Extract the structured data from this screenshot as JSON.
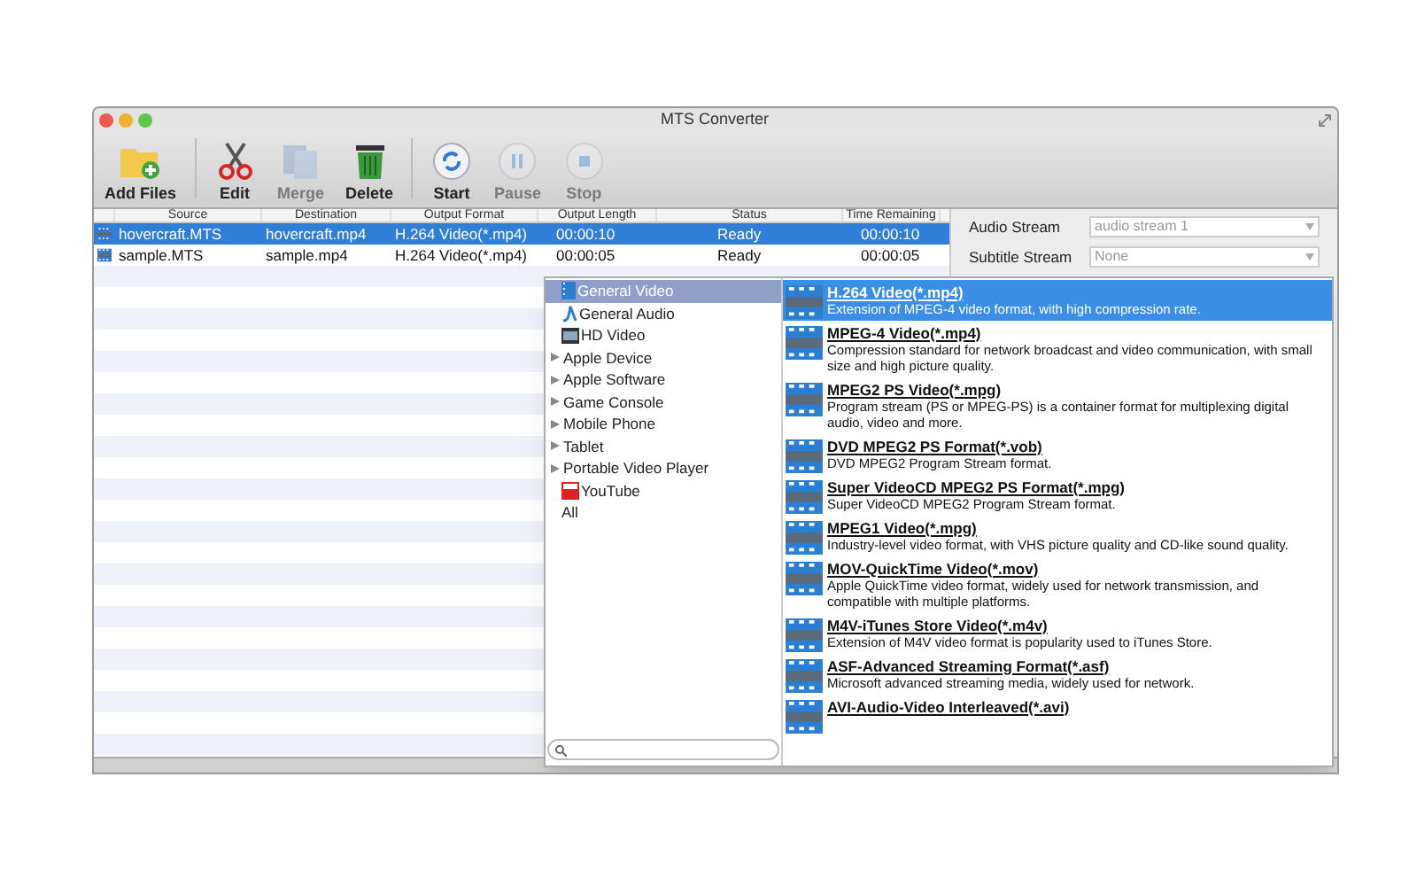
{
  "window": {
    "title": "MTS Converter"
  },
  "toolbar": [
    {
      "label": "Add Files",
      "kind": "add",
      "disabled": false
    },
    {
      "label": "Edit",
      "kind": "edit",
      "disabled": false
    },
    {
      "label": "Merge",
      "kind": "merge",
      "disabled": true
    },
    {
      "label": "Delete",
      "kind": "delete",
      "disabled": false
    },
    {
      "label": "Start",
      "kind": "start",
      "disabled": false
    },
    {
      "label": "Pause",
      "kind": "pause",
      "disabled": true
    },
    {
      "label": "Stop",
      "kind": "stop",
      "disabled": true
    }
  ],
  "table": {
    "columns": [
      "Source",
      "Destination",
      "Output Format",
      "Output Length",
      "Status",
      "Time Remaining"
    ],
    "rows": [
      {
        "selected": true,
        "cells": [
          "hovercraft.MTS",
          "hovercraft.mp4",
          "H.264 Video(*.mp4)",
          "00:00:10",
          "Ready",
          "00:00:10"
        ]
      },
      {
        "selected": false,
        "cells": [
          "sample.MTS",
          "sample.mp4",
          "H.264 Video(*.mp4)",
          "00:00:05",
          "Ready",
          "00:00:05"
        ]
      }
    ]
  },
  "streams": [
    {
      "label": "Audio Stream",
      "value": "audio stream 1"
    },
    {
      "label": "Subtitle Stream",
      "value": "None"
    }
  ],
  "categories": [
    {
      "label": "General Video",
      "kind": "video",
      "selected": true
    },
    {
      "label": "General Audio",
      "kind": "audio",
      "selected": false
    },
    {
      "label": "HD Video",
      "kind": "hd",
      "selected": false
    },
    {
      "label": "Apple Device",
      "kind": "group",
      "selected": false,
      "expanded": false
    },
    {
      "label": "Apple Software",
      "kind": "group",
      "selected": false,
      "expanded": false
    },
    {
      "label": "Game Console",
      "kind": "group",
      "selected": false,
      "expanded": false
    },
    {
      "label": "Mobile Phone",
      "kind": "group",
      "selected": false,
      "expanded": false
    },
    {
      "label": "Tablet",
      "kind": "group",
      "selected": false,
      "expanded": false
    },
    {
      "label": "Portable Video Player",
      "kind": "group",
      "selected": false,
      "expanded": false
    },
    {
      "label": "YouTube",
      "kind": "youtube",
      "selected": false
    },
    {
      "label": "All",
      "kind": "plain",
      "selected": false
    }
  ],
  "formats": [
    {
      "title": "H.264 Video(*.mp4)",
      "description": "Extension of MPEG-4 video format, with high compression rate.",
      "selected": true
    },
    {
      "title": "MPEG-4 Video(*.mp4)",
      "description": "Compression standard for network broadcast and video communication, with small size and high picture quality.",
      "selected": false
    },
    {
      "title": "MPEG2 PS Video(*.mpg)",
      "description": "Program stream (PS or MPEG-PS) is a container format for multiplexing digital audio, video and more.",
      "selected": false
    },
    {
      "title": "DVD MPEG2 PS Format(*.vob)",
      "description": "DVD MPEG2 Program Stream format.",
      "selected": false
    },
    {
      "title": "Super VideoCD MPEG2 PS Format(*.mpg)",
      "description": "Super VideoCD MPEG2 Program Stream format.",
      "selected": false
    },
    {
      "title": "MPEG1 Video(*.mpg)",
      "description": "Industry-level video format, with VHS picture quality and CD-like sound quality.",
      "selected": false
    },
    {
      "title": "MOV-QuickTime Video(*.mov)",
      "description": "Apple QuickTime video format, widely used for network transmission, and compatible with multiple platforms.",
      "selected": false
    },
    {
      "title": "M4V-iTunes Store Video(*.m4v)",
      "description": "Extension of M4V video format is popularity used to iTunes Store.",
      "selected": false
    },
    {
      "title": "ASF-Advanced Streaming Format(*.asf)",
      "description": "Microsoft advanced streaming media, widely used for network.",
      "selected": false
    },
    {
      "title": "AVI-Audio-Video Interleaved(*.avi)",
      "selected": false
    }
  ]
}
